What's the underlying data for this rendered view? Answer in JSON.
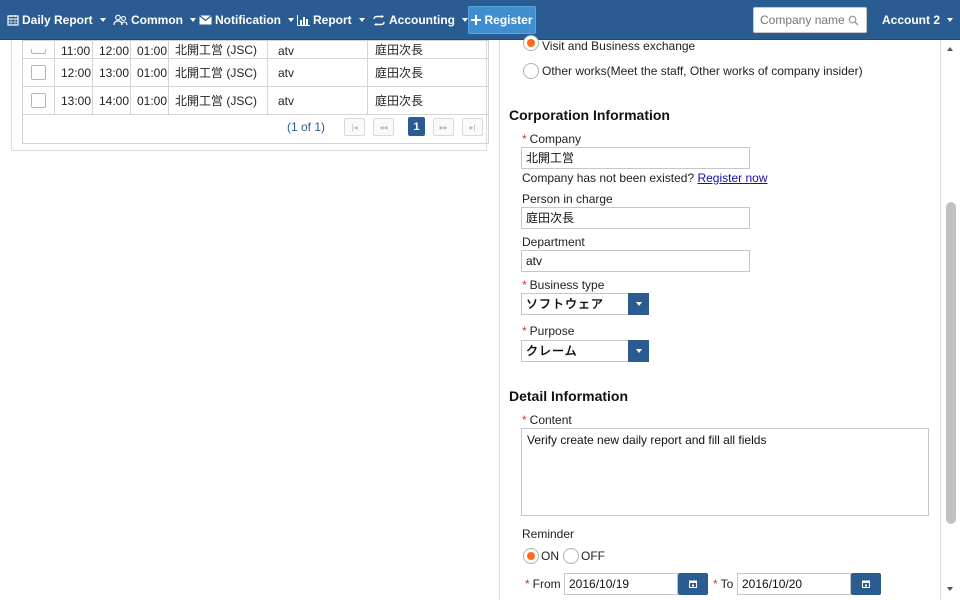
{
  "navbar": {
    "daily_report": "Daily Report",
    "common": "Common",
    "notification": "Notification",
    "report": "Report",
    "accounting": "Accounting",
    "register": "Register",
    "search_placeholder": "Company name",
    "account": "Account 2",
    "colors": {
      "bar": "#2a5c91",
      "register_button": "#3e8ed0"
    }
  },
  "table": {
    "rows": [
      {
        "start": "11:00",
        "end": "12:00",
        "duration": "01:00",
        "company": "北開工営 (JSC)",
        "department": "atv",
        "person": "庭田次長"
      },
      {
        "start": "12:00",
        "end": "13:00",
        "duration": "01:00",
        "company": "北開工営 (JSC)",
        "department": "atv",
        "person": "庭田次長"
      },
      {
        "start": "13:00",
        "end": "14:00",
        "duration": "01:00",
        "company": "北開工営 (JSC)",
        "department": "atv",
        "person": "庭田次長"
      }
    ],
    "pagination": {
      "label": "(1 of 1)",
      "current_page": "1"
    }
  },
  "form": {
    "work_type": {
      "option_visit": "Visit and Business exchange",
      "option_other": "Other works(Meet the staff, Other works of company insider)",
      "selected": "Visit and Business exchange"
    },
    "corporation": {
      "title": "Corporation Information",
      "company_label": "Company",
      "company_value": "北開工営",
      "company_note": "Company has not been existed?",
      "register_now": "Register now",
      "person_label": "Person in charge",
      "person_value": "庭田次長",
      "department_label": "Department",
      "department_value": "atv",
      "business_type_label": "Business type",
      "business_type_value": "ソフトウェア",
      "purpose_label": "Purpose",
      "purpose_value": "クレーム"
    },
    "detail": {
      "title": "Detail Information",
      "content_label": "Content",
      "content_value": "Verify create new daily report and fill all fields",
      "reminder_label": "Reminder",
      "reminder_on": "ON",
      "reminder_off": "OFF",
      "reminder_selected": "ON",
      "from_label": "From",
      "from_value": "2016/10/19",
      "to_label": "To",
      "to_value": "2016/10/20"
    }
  },
  "icons": {
    "daily_report": "calendar-icon",
    "common": "users-icon",
    "notification": "envelope-icon",
    "report": "bar-chart-icon",
    "accounting": "exchange-icon",
    "register": "plus-icon",
    "search": "search-icon",
    "date_picker": "calendar-icon"
  }
}
